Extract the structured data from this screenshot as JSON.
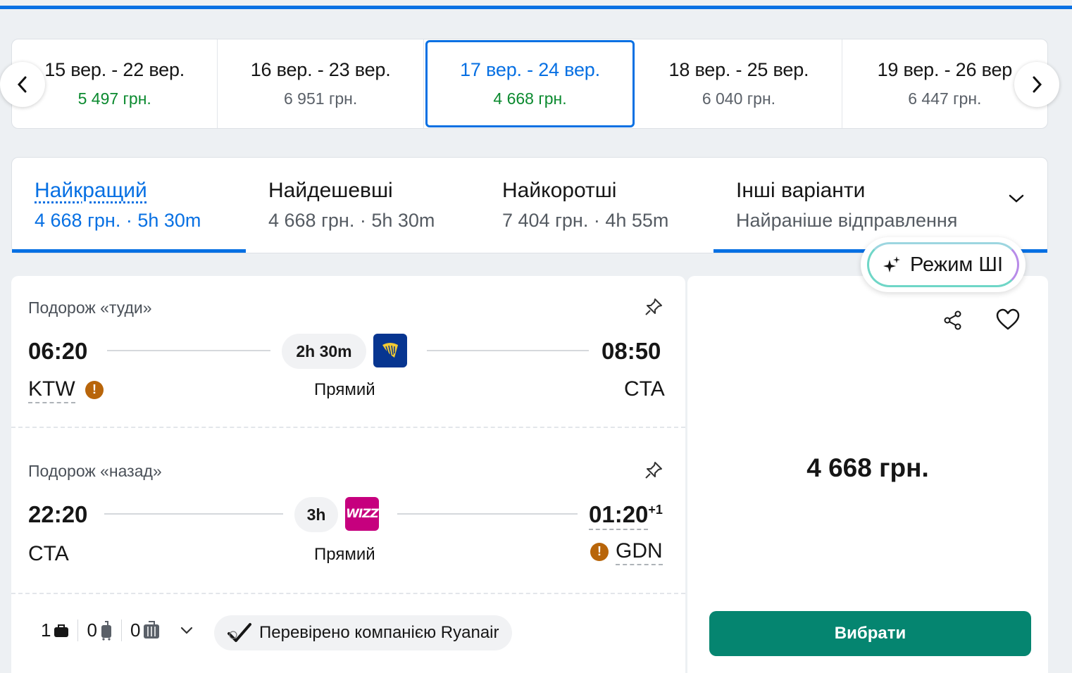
{
  "date_strip": [
    {
      "range": "15 вер. - 22 вер.",
      "price": "5 497 грн.",
      "highlight": true,
      "selected": false
    },
    {
      "range": "16 вер. - 23 вер.",
      "price": "6 951 грн.",
      "highlight": false,
      "selected": false
    },
    {
      "range": "17 вер. - 24 вер.",
      "price": "4 668 грн.",
      "highlight": true,
      "selected": true
    },
    {
      "range": "18 вер. - 25 вер.",
      "price": "6 040 грн.",
      "highlight": false,
      "selected": false
    },
    {
      "range": "19 вер. - 26 вер",
      "price": "6 447 грн.",
      "highlight": false,
      "selected": false
    }
  ],
  "sort_tabs": [
    {
      "title": "Найкращий",
      "sub": "4 668 грн. · 5h 30m"
    },
    {
      "title": "Найдешевші",
      "sub": "4 668 грн. · 5h 30m"
    },
    {
      "title": "Найкоротші",
      "sub": "7 404 грн. · 4h 55m"
    },
    {
      "title": "Інші варіанти",
      "sub": "Найраніше відправлення"
    }
  ],
  "ai_mode_label": "Режим ШІ",
  "outbound": {
    "label": "Подорож «туди»",
    "depart_time": "06:20",
    "depart_airport": "KTW",
    "arrive_time": "08:50",
    "arrive_airport": "CTA",
    "duration": "2h 30m",
    "stops": "Прямий",
    "airline_logo": "ryanair-logo"
  },
  "inbound": {
    "label": "Подорож «назад»",
    "depart_time": "22:20",
    "depart_airport": "CTA",
    "arrive_time": "01:20",
    "arrive_day_offset": "+1",
    "arrive_airport": "GDN",
    "duration": "3h",
    "stops": "Прямий",
    "airline_logo": "wizz-logo"
  },
  "bags": {
    "personal": "1",
    "cabin": "0",
    "checked": "0"
  },
  "verified_text": "Перевірено компанією Ryanair",
  "price": "4 668 грн.",
  "select_label": "Вибрати",
  "colors": {
    "accent": "#0770e3",
    "green_price": "#0b8a2f",
    "select_button": "#058570",
    "warning": "#b8650a"
  }
}
